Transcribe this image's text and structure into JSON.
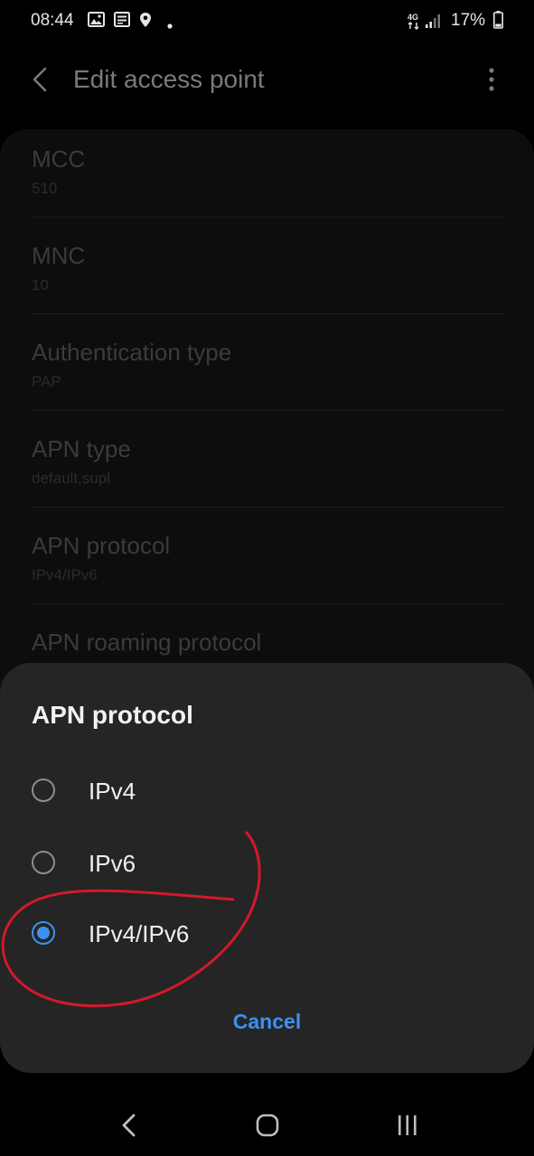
{
  "status_bar": {
    "time": "08:44",
    "network": "4G",
    "battery": "17%"
  },
  "app_bar": {
    "title": "Edit access point"
  },
  "settings": [
    {
      "label": "MCC",
      "value": "510"
    },
    {
      "label": "MNC",
      "value": "10"
    },
    {
      "label": "Authentication type",
      "value": "PAP"
    },
    {
      "label": "APN type",
      "value": "default,supl"
    },
    {
      "label": "APN protocol",
      "value": "IPv4/IPv6"
    },
    {
      "label": "APN roaming protocol",
      "value": ""
    }
  ],
  "dialog": {
    "title": "APN protocol",
    "options": [
      {
        "label": "IPv4",
        "selected": false
      },
      {
        "label": "IPv6",
        "selected": false
      },
      {
        "label": "IPv4/IPv6",
        "selected": true
      }
    ],
    "cancel_label": "Cancel"
  },
  "colors": {
    "accent": "#3e91f0",
    "annotation": "#d11a2a"
  }
}
